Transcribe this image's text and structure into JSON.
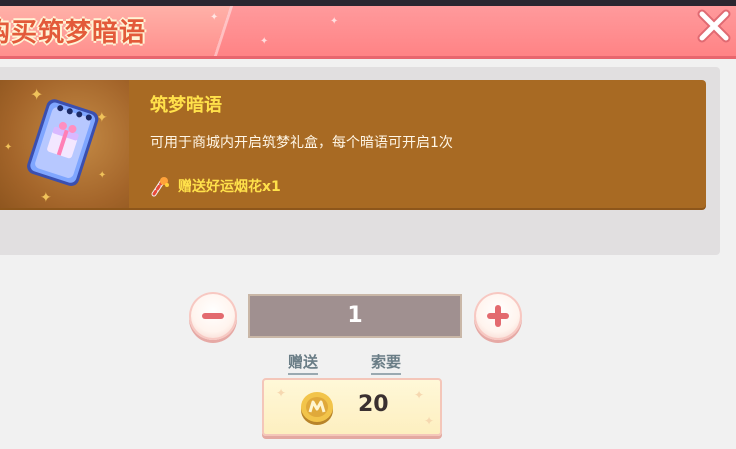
{
  "dialog": {
    "title": "购买筑梦暗语",
    "close_icon": "close-icon"
  },
  "item": {
    "name": "筑梦暗语",
    "description": "可用于商城内开启筑梦礼盒，每个暗语可开启1次",
    "bonus": "赠送好运烟花x1",
    "bonus_icon": "firework-icon",
    "thumbnail_icon": "gift-ticket-icon"
  },
  "quantity": {
    "value": "1",
    "decrease_icon": "minus-icon",
    "increase_icon": "plus-icon"
  },
  "actions": {
    "gift_label": "赠送",
    "request_label": "索要"
  },
  "purchase": {
    "price": "20",
    "currency_icon": "coin-icon"
  },
  "colors": {
    "header": "#ff8385",
    "title": "#e35a3a",
    "card": "#a86a23",
    "item_name": "#ffe14a",
    "quantity_box": "#a09090"
  }
}
